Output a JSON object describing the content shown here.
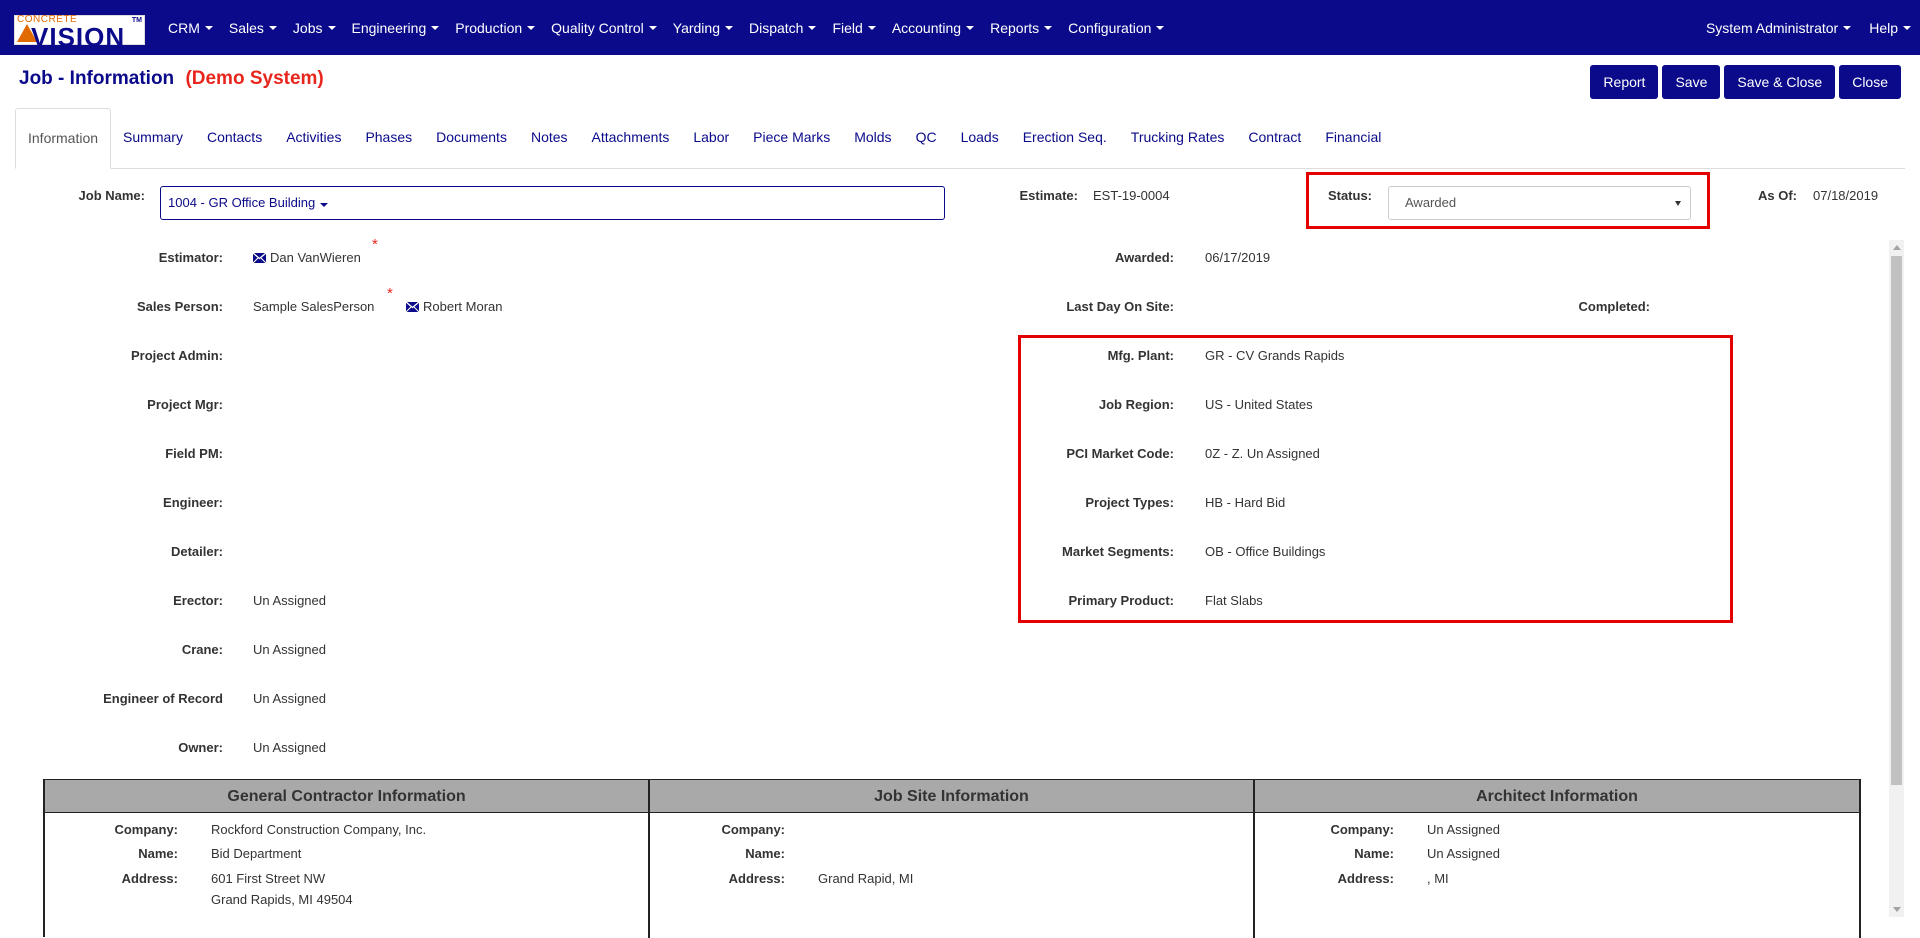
{
  "nav": {
    "logo_top": "CONCRETE",
    "logo_main": "VISION",
    "logo_tm": "TM",
    "menus": [
      "CRM",
      "Sales",
      "Jobs",
      "Engineering",
      "Production",
      "Quality Control",
      "Yarding",
      "Dispatch",
      "Field",
      "Accounting",
      "Reports",
      "Configuration"
    ],
    "user": "System Administrator",
    "help": "Help"
  },
  "header": {
    "title": "Job - Information",
    "demo": "(Demo System)",
    "buttons": {
      "report": "Report",
      "save": "Save",
      "save_close": "Save & Close",
      "close": "Close"
    }
  },
  "tabs": [
    "Information",
    "Summary",
    "Contacts",
    "Activities",
    "Phases",
    "Documents",
    "Notes",
    "Attachments",
    "Labor",
    "Piece Marks",
    "Molds",
    "QC",
    "Loads",
    "Erection Seq.",
    "Trucking Rates",
    "Contract",
    "Financial"
  ],
  "form": {
    "job_name_label": "Job Name:",
    "job_name_value": "1004 - GR Office Building",
    "estimate_label": "Estimate:",
    "estimate_value": "EST-19-0004",
    "status_label": "Status:",
    "status_value": "Awarded",
    "as_of_label": "As Of:",
    "as_of_value": "07/18/2019",
    "left": [
      {
        "label": "Estimator:",
        "value": "Dan VanWieren"
      },
      {
        "label": "Sales Person:",
        "value": "Sample SalesPerson",
        "value2": "Robert Moran"
      },
      {
        "label": "Project Admin:",
        "value": ""
      },
      {
        "label": "Project Mgr:",
        "value": ""
      },
      {
        "label": "Field PM:",
        "value": ""
      },
      {
        "label": "Engineer:",
        "value": ""
      },
      {
        "label": "Detailer:",
        "value": ""
      },
      {
        "label": "Erector:",
        "value": "Un Assigned"
      },
      {
        "label": "Crane:",
        "value": "Un Assigned"
      },
      {
        "label": "Engineer of Record",
        "value": "Un Assigned"
      },
      {
        "label": "Owner:",
        "value": "Un Assigned"
      }
    ],
    "awarded_label": "Awarded:",
    "awarded_value": "06/17/2019",
    "last_day_label": "Last Day On Site:",
    "last_day_value": "",
    "completed_label": "Completed:",
    "completed_value": "",
    "right": [
      {
        "label": "Mfg. Plant:",
        "value": "GR - CV Grands Rapids"
      },
      {
        "label": "Job Region:",
        "value": "US - United States"
      },
      {
        "label": "PCI Market Code:",
        "value": "0Z - Z. Un Assigned"
      },
      {
        "label": "Project Types:",
        "value": "HB - Hard Bid"
      },
      {
        "label": "Market Segments:",
        "value": "OB - Office Buildings"
      },
      {
        "label": "Primary Product:",
        "value": "Flat Slabs"
      }
    ]
  },
  "info_table": {
    "general_contractor": {
      "title": "General Contractor Information",
      "company_label": "Company:",
      "company": "Rockford Construction Company, Inc.",
      "name_label": "Name:",
      "name": "Bid Department",
      "address_label": "Address:",
      "address1": "601 First Street NW",
      "address2": "Grand Rapids, MI 49504"
    },
    "job_site": {
      "title": "Job Site Information",
      "company_label": "Company:",
      "company": "",
      "name_label": "Name:",
      "name": "",
      "address_label": "Address:",
      "address1": "Grand Rapid, MI"
    },
    "architect": {
      "title": "Architect Information",
      "company_label": "Company:",
      "company": "Un Assigned",
      "name_label": "Name:",
      "name": "Un Assigned",
      "address_label": "Address:",
      "address1": ", MI"
    }
  },
  "colors": {
    "brand_navy": "#0a0a8a",
    "demo_red": "#e8261d",
    "highlight_red": "#e30000",
    "table_header": "#a9a9a9"
  }
}
